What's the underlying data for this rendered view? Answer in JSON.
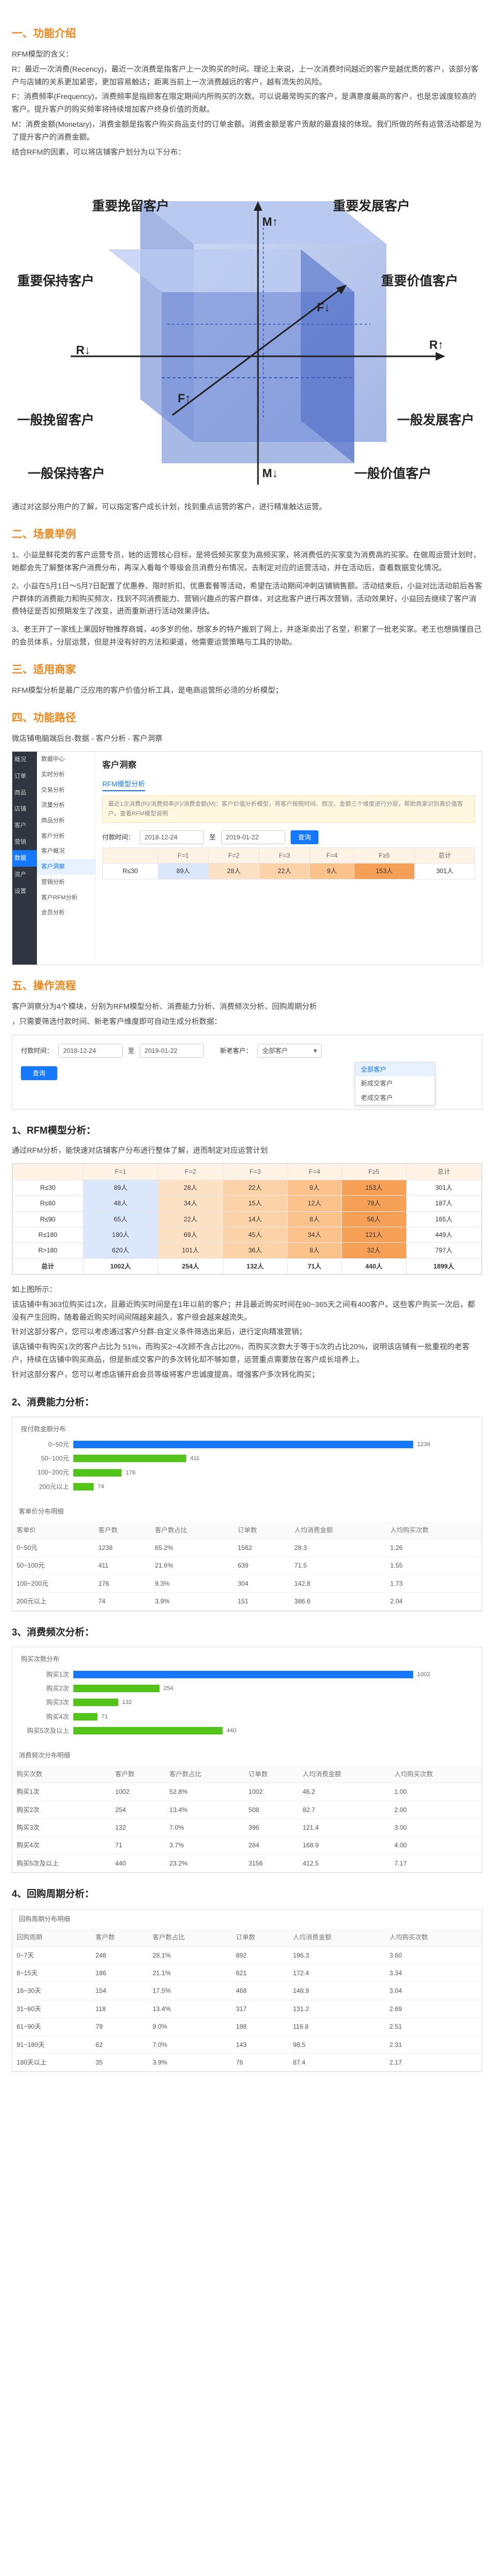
{
  "sec1": {
    "title": "一、功能介绍",
    "intro": "RFM模型的含义：",
    "r": "R：最近一次消费(Recency)，最近一次消费是指客户上一次购买的时间。理论上来说，上一次消费时间越近的客户是越优质的客户，该部分客户与店铺的关系更加紧密，更加容易触达；距离当前上一次消费越远的客户，越有流失的风险。",
    "f": "F：消费频率(Frequency)，消费频率是指顾客在限定期间内所购买的次数。可以说最常购买的客户，是满意度最高的客户，也是忠诚度较高的客户。提升客户的购买频率将持续增加客户终身价值的贡献。",
    "m": "M：消费金额(Monetary)，消费金额是指客户购买商品支付的订单金额。消费金额是客户贡献的最直接的体现。我们所做的所有运营活动都是为了提升客户的消费金额。",
    "combine": "结合RFM的因素，可以将店铺客户划分为以下分布：",
    "after": "通过对这部分用户的了解，可以指定客户成长计划，找到重点运营的客户，进行精准触达运营。"
  },
  "cube": {
    "labels": [
      "重要挽留客户",
      "重要发展客户",
      "重要保持客户",
      "重要价值客户",
      "一般挽留客户",
      "一般发展客户",
      "一般保持客户",
      "一般价值客户"
    ],
    "axes": [
      "M↑",
      "F↓",
      "R↓",
      "R↑",
      "F↑",
      "M↓"
    ]
  },
  "sec2": {
    "title": "二、场景举例",
    "p1": "1、小益是鲜花类的客户运营专员，她的运营核心目标，是将低频买家变为高频买家，将消费低的买家变为消费高的买家。在做周运营计划时，她都会先了解整体客户消费分布，再深入看每个等级会员消费分布情况，去制定对应的运营活动，并在活动后，查看数据变化情况。",
    "p2": "2、小益在5月1日～5月7日配置了优惠券、限时折扣、优惠套餐等活动，希望在活动期间冲刺店铺销售额。活动结束后，小益对比活动前后各客户群体的消费能力和购买频次，找到不同消费能力、营销兴趣点的客户群体，对这批客户进行再次营销，活动效果好，小益回去继续了客户消费特征是否如预期发生了改变，进而重新进行活动效果评估。",
    "p3": "3、老王开了一家线上果园好物推荐商城，40多岁的他，想家乡的特产搬到了网上，并逐渐卖出了名堂，积累了一批老买家。老王也想搞懂自己的会员体系，分层运营，但是并没有好的方法和渠道，他需要运营策略与工具的协助。"
  },
  "sec3": {
    "title": "三、适用商家",
    "text": "RFM模型分析是最广泛应用的客户价值分析工具，是电商运营所必须的分析模型；"
  },
  "sec4": {
    "title": "四、功能路径",
    "path": "微店铺电脑端后台-数据 - 客户分析 - 客户洞察",
    "side": [
      "概况",
      "订单",
      "商品",
      "店铺",
      "客户",
      "营销",
      "数据",
      "资产",
      "设置"
    ],
    "menu": [
      "数据中心",
      "实时分析",
      "交易分析",
      "流量分析",
      "商品分析",
      "客户分析",
      "客户概况",
      "客户洞察",
      "营销分析",
      "客户RFM分析",
      "会员分析"
    ],
    "page_title": "客户洞察",
    "tab": "RFM模型分析",
    "tip": "最近1次消费(R)/消费频率(F)/消费金额(M)：客户价值分析模型，将客户按照时间、频次、金额三个维度进行分层，帮助商家识别高价值客户。查看RFM模型说明"
  },
  "sec5": {
    "title": "五、操作流程",
    "intro1": "客户洞察分为4个模块，分别为RFM模型分析、消费能力分析、消费频次分析、回购周期分析",
    "intro2": "，只需要筛选付款时间、新老客户维度即可自动生成分析数据：",
    "filter_label": "付款时间：",
    "date_start": "2018-12-24",
    "date_sep": "至",
    "date_end": "2019-01-22",
    "cust_label": "新老客户：",
    "cust_value": "全部客户",
    "query": "查询",
    "options": [
      "全部客户",
      "新成交客户",
      "老成交客户"
    ]
  },
  "s1": {
    "title": "1、RFM模型分析：",
    "desc": "通过RFM分析，能快速对店铺客户分布进行整体了解，进而制定对应运营计划",
    "header": [
      "",
      "F=1",
      "F=2",
      "F=3",
      "F=4",
      "F≥5",
      "总计"
    ],
    "rows": [
      [
        "R≤30",
        "89人",
        "28人",
        "22人",
        "9人",
        "153人",
        "301人"
      ],
      [
        "R≤60",
        "48人",
        "34人",
        "15人",
        "12人",
        "78人",
        "187人"
      ],
      [
        "R≤90",
        "65人",
        "22人",
        "14人",
        "8人",
        "56人",
        "165人"
      ],
      [
        "R≤180",
        "180人",
        "69人",
        "45人",
        "34人",
        "121人",
        "449人"
      ],
      [
        "R>180",
        "620人",
        "101人",
        "36人",
        "8人",
        "32人",
        "797人"
      ],
      [
        "总计",
        "1002人",
        "254人",
        "132人",
        "71人",
        "440人",
        "1899人"
      ]
    ],
    "eg": "如上图所示：",
    "n1": "该店铺中有363位购买过1次，且最近购买时间是在1年以前的客户；并且最近购买时间在90~365天之间有400客户。这些客户购买一次后，都没有产生回购，随着最近购买时间间隔越来越久，客户很会越来越流失。",
    "n2": "针对这部分客户，您可以考虑通过客户分群-自定义条件筛选出来后，进行定向精准营销；",
    "n3": "该店铺中有购买1次的客户占比为 51%，而购买2~4次顾不含占比20%，而购买次数大于等于5次的占比20%，说明该店铺有一批重视的老客户，持续在店铺中购买商品，但是新成交客户的多次转化却不够如意，运营重点需要放在客户成长培养上。",
    "n4": "针对这部分客户，您可以考虑店铺开启会员等级将客户忠诚度提高，增强客户多次转化购买；"
  },
  "s2": {
    "title": "2、消费能力分析：",
    "chart_caption": "按付款金额分布",
    "table_caption": "客单价分布明细",
    "cols": [
      "客单价",
      "客户数",
      "客户数占比",
      "订单数",
      "人均消费金额",
      "人均购买次数"
    ],
    "rows": [
      [
        "0~50元",
        "1238",
        "65.2%",
        "1562",
        "28.3",
        "1.26"
      ],
      [
        "50~100元",
        "411",
        "21.6%",
        "639",
        "71.5",
        "1.55"
      ],
      [
        "100~200元",
        "176",
        "9.3%",
        "304",
        "142.8",
        "1.73"
      ],
      [
        "200元以上",
        "74",
        "3.9%",
        "151",
        "386.6",
        "2.04"
      ]
    ]
  },
  "s3": {
    "title": "3、消费频次分析：",
    "chart_caption": "购买次数分布",
    "table_caption": "消费频次分布明细",
    "cols": [
      "购买次数",
      "客户数",
      "客户数占比",
      "订单数",
      "人均消费金额",
      "人均购买次数"
    ],
    "rows": [
      [
        "购买1次",
        "1002",
        "52.8%",
        "1002",
        "46.2",
        "1.00"
      ],
      [
        "购买2次",
        "254",
        "13.4%",
        "508",
        "82.7",
        "2.00"
      ],
      [
        "购买3次",
        "132",
        "7.0%",
        "396",
        "121.4",
        "3.00"
      ],
      [
        "购买4次",
        "71",
        "3.7%",
        "284",
        "168.9",
        "4.00"
      ],
      [
        "购买5次及以上",
        "440",
        "23.2%",
        "3156",
        "412.5",
        "7.17"
      ]
    ]
  },
  "s4": {
    "title": "4、回购周期分析：",
    "table_caption": "回购周期分布明细",
    "cols": [
      "回购周期",
      "客户数",
      "客户数占比",
      "订单数",
      "人均消费金额",
      "人均购买次数"
    ],
    "rows": [
      [
        "0~7天",
        "248",
        "28.1%",
        "892",
        "196.3",
        "3.60"
      ],
      [
        "8~15天",
        "186",
        "21.1%",
        "621",
        "172.4",
        "3.34"
      ],
      [
        "16~30天",
        "154",
        "17.5%",
        "468",
        "148.9",
        "3.04"
      ],
      [
        "31~60天",
        "118",
        "13.4%",
        "317",
        "131.2",
        "2.69"
      ],
      [
        "61~90天",
        "79",
        "9.0%",
        "198",
        "116.8",
        "2.51"
      ],
      [
        "91~180天",
        "62",
        "7.0%",
        "143",
        "98.5",
        "2.31"
      ],
      [
        "180天以上",
        "35",
        "3.9%",
        "76",
        "87.4",
        "2.17"
      ]
    ]
  },
  "chart_data": [
    {
      "type": "bar",
      "categories": [
        "0~50元",
        "50~100元",
        "100~200元",
        "200元以上"
      ],
      "values": [
        1238,
        411,
        176,
        74
      ],
      "title": "",
      "xlabel": "",
      "ylabel": ""
    },
    {
      "type": "bar",
      "categories": [
        "购买1次",
        "购买2次",
        "购买3次",
        "购买4次",
        "购买5次及以上"
      ],
      "values": [
        1002,
        254,
        132,
        71,
        440
      ],
      "title": "",
      "xlabel": "",
      "ylabel": ""
    }
  ],
  "colors": {
    "accent": "#f08519",
    "blue": "#1677ff",
    "green": "#52c41a"
  }
}
